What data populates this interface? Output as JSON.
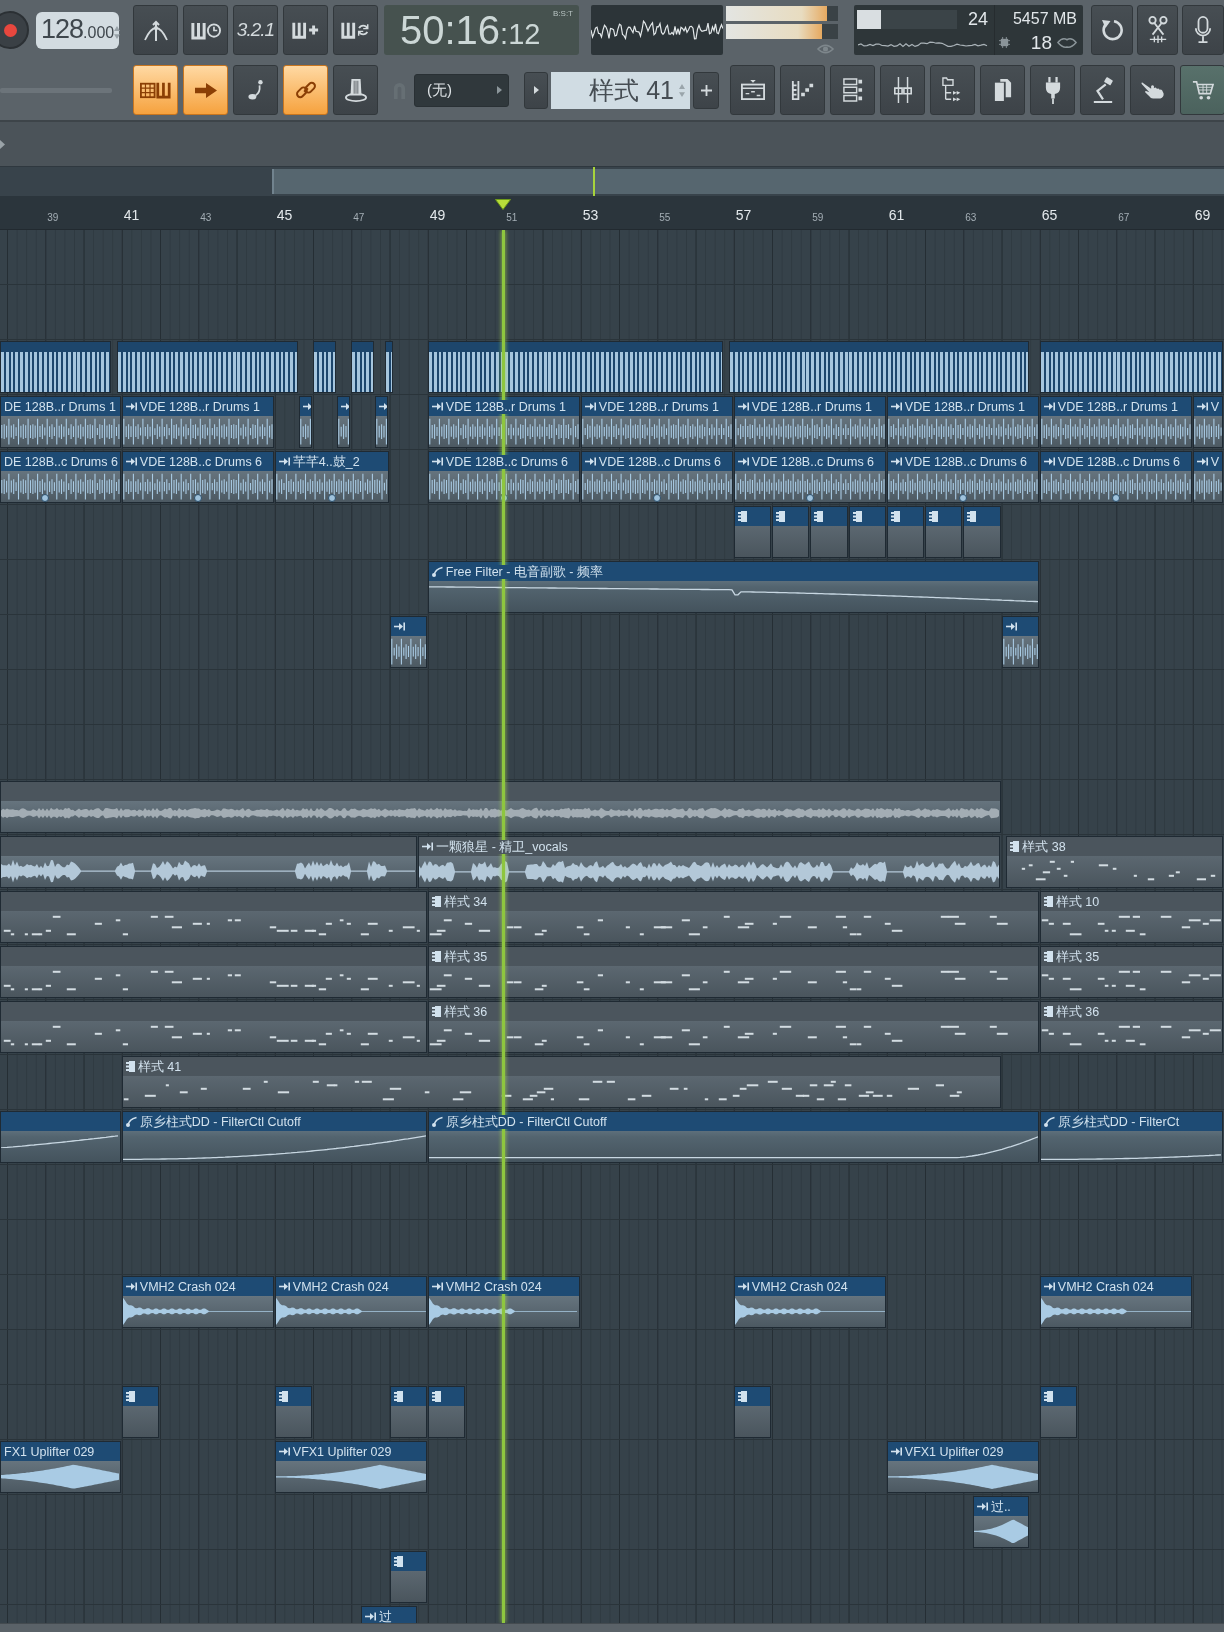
{
  "toolbar": {
    "tempo": {
      "value": "128",
      "decimals": ".000"
    },
    "record_buttons": [
      {
        "kind": "metronome",
        "on": false
      },
      {
        "kind": "keys-clock",
        "on": false
      },
      {
        "kind": "countdown",
        "label": "3.2.1",
        "on": false
      },
      {
        "kind": "keys-plus",
        "on": false
      },
      {
        "kind": "keys-loop",
        "on": false
      }
    ],
    "time": {
      "value": "50:16",
      "ticks": ":12",
      "format": "B:S:T"
    },
    "peak_meters": [
      {
        "level": 0.9
      },
      {
        "level": 0.86
      }
    ],
    "cpu": {
      "reading": "24",
      "level": 0.24
    },
    "memory": "5457 MB",
    "polyphony": "18",
    "tool_buttons": [
      {
        "kind": "undo"
      },
      {
        "kind": "scissors"
      },
      {
        "kind": "microphone"
      }
    ],
    "mode_toggles": [
      {
        "kind": "keys-grid",
        "on": true
      },
      {
        "kind": "arrow",
        "on": true
      },
      {
        "kind": "step",
        "on": false
      },
      {
        "kind": "link",
        "on": true
      },
      {
        "kind": "knob",
        "on": false
      }
    ],
    "snap": {
      "value": "(无)"
    },
    "pattern_selector": {
      "value": "样式 41"
    },
    "window_buttons": [
      {
        "kind": "playlist"
      },
      {
        "kind": "piano-roll"
      },
      {
        "kind": "channel-rack"
      },
      {
        "kind": "mixer"
      },
      {
        "kind": "browser"
      },
      {
        "kind": "files"
      },
      {
        "kind": "plugin"
      },
      {
        "kind": "lamp"
      },
      {
        "kind": "hand"
      },
      {
        "kind": "cart"
      }
    ]
  },
  "playlist": {
    "ruler": [
      "39",
      "41",
      "43",
      "45",
      "47",
      "49",
      "51",
      "53",
      "55",
      "57",
      "59",
      "61",
      "63",
      "65",
      "67",
      "69"
    ],
    "tracks": [
      {
        "clips": [
          {
            "kind": "slices",
            "color": "#1d466c"
          },
          {
            "kind": "slices",
            "color": "#1d466c"
          },
          {
            "kind": "slices",
            "color": "#1d466c"
          },
          {
            "kind": "slices",
            "color": "#1d466c"
          },
          {
            "kind": "slices",
            "color": "#1d466c"
          },
          {
            "kind": "slices",
            "color": "#1d466c"
          },
          {
            "kind": "slices",
            "color": "#1d466c"
          },
          {
            "kind": "slices",
            "color": "#1d466c"
          }
        ]
      },
      {
        "clips": [
          {
            "kind": "audio",
            "color": "#1e4b74",
            "label": "DE 128B..r Drums 1"
          },
          {
            "kind": "audio",
            "color": "#1e4b74",
            "label": "VDE 128B..r Drums 1"
          },
          {
            "kind": "audio",
            "color": "#1e4b74"
          },
          {
            "kind": "audio",
            "color": "#1e4b74"
          },
          {
            "kind": "audio",
            "color": "#1e4b74"
          },
          {
            "kind": "audio",
            "color": "#1e4b74",
            "label": "VDE 128B..r Drums 1"
          },
          {
            "kind": "audio",
            "color": "#1e4b74",
            "label": "VDE 128B..r Drums 1"
          },
          {
            "kind": "audio",
            "color": "#1e4b74",
            "label": "VDE 128B..r Drums 1"
          },
          {
            "kind": "audio",
            "color": "#1e4b74",
            "label": "VDE 128B..r Drums 1"
          },
          {
            "kind": "audio",
            "color": "#1e4b74",
            "label": "VDE 128B..r Drums 1"
          },
          {
            "kind": "audio",
            "color": "#1e4b74",
            "label": "V"
          }
        ]
      },
      {
        "clips": [
          {
            "kind": "audio",
            "color": "#1e4b74",
            "label": "DE 128B..c Drums 6",
            "marker": true
          },
          {
            "kind": "audio",
            "color": "#1e4b74",
            "label": "VDE 128B..c Drums 6",
            "marker": true
          },
          {
            "kind": "audio",
            "color": "#1e4b74",
            "label": "芊芊4..鼓_2",
            "marker": true
          },
          {
            "kind": "audio",
            "color": "#1e4b74",
            "label": "VDE 128B..c Drums 6",
            "marker": true
          },
          {
            "kind": "audio",
            "color": "#1e4b74",
            "label": "VDE 128B..c Drums 6",
            "marker": true
          },
          {
            "kind": "audio",
            "color": "#1e4b74",
            "label": "VDE 128B..c Drums 6",
            "marker": true
          },
          {
            "kind": "audio",
            "color": "#1e4b74",
            "label": "VDE 128B..c Drums 6",
            "marker": true
          },
          {
            "kind": "audio",
            "color": "#1e4b74",
            "label": "VDE 128B..c Drums 6",
            "marker": true
          },
          {
            "kind": "audio",
            "color": "#1e4b74",
            "label": "V"
          }
        ]
      },
      {
        "clips": [
          {
            "kind": "pattern",
            "color": "#1e4b74"
          },
          {
            "kind": "pattern",
            "color": "#1e4b74"
          },
          {
            "kind": "pattern",
            "color": "#1e4b74"
          },
          {
            "kind": "pattern",
            "color": "#1e4b74"
          },
          {
            "kind": "pattern",
            "color": "#1e4b74"
          },
          {
            "kind": "pattern",
            "color": "#1e4b74"
          },
          {
            "kind": "pattern",
            "color": "#1e4b74"
          }
        ]
      },
      {
        "clips": [
          {
            "kind": "automation",
            "color": "#1e4b74",
            "label": "Free Filter - 电音副歌 - 频率"
          }
        ]
      },
      {
        "clips": [
          {
            "kind": "audio",
            "color": "#1e4b74"
          },
          {
            "kind": "audio",
            "color": "#1e4b74"
          }
        ]
      },
      {
        "clips": [
          {
            "kind": "audio",
            "color": "#4b555d"
          }
        ]
      },
      {
        "clips": [
          {
            "kind": "audio",
            "color": "#4b555d"
          },
          {
            "kind": "audio",
            "color": "#4b555d",
            "label": "一颗狼星 - 精卫_vocals"
          },
          {
            "kind": "pattern",
            "color": "#4b555d",
            "label": "样式 38"
          }
        ]
      },
      {
        "clips": [
          {
            "kind": "pattern",
            "color": "#4b555d"
          },
          {
            "kind": "pattern",
            "color": "#4b555d",
            "label": "样式 34"
          },
          {
            "kind": "pattern",
            "color": "#4b555d",
            "label": "样式 10"
          }
        ]
      },
      {
        "clips": [
          {
            "kind": "pattern",
            "color": "#4b555d"
          },
          {
            "kind": "pattern",
            "color": "#4b555d",
            "label": "样式 35"
          },
          {
            "kind": "pattern",
            "color": "#4b555d",
            "label": "样式 35"
          }
        ]
      },
      {
        "clips": [
          {
            "kind": "pattern",
            "color": "#4b555d"
          },
          {
            "kind": "pattern",
            "color": "#4b555d",
            "label": "样式 36"
          },
          {
            "kind": "pattern",
            "color": "#4b555d",
            "label": "样式 36"
          }
        ]
      },
      {
        "clips": [
          {
            "kind": "pattern",
            "color": "#4b555d",
            "label": "样式 41"
          }
        ]
      },
      {
        "clips": [
          {
            "kind": "automation",
            "color": "#1e4b74"
          },
          {
            "kind": "automation",
            "color": "#1e4b74",
            "label": "原乡柱式DD - FilterCtl Cutoff"
          },
          {
            "kind": "automation",
            "color": "#1e4b74",
            "label": "原乡柱式DD - FilterCtl Cutoff"
          },
          {
            "kind": "automation",
            "color": "#1e4b74",
            "label": "原乡柱式DD - FilterCt"
          }
        ]
      },
      {
        "clips": [
          {
            "kind": "audio",
            "color": "#1e4b74",
            "label": "VMH2 Crash 024"
          },
          {
            "kind": "audio",
            "color": "#1e4b74",
            "label": "VMH2 Crash 024"
          },
          {
            "kind": "audio",
            "color": "#1e4b74",
            "label": "VMH2 Crash 024"
          },
          {
            "kind": "audio",
            "color": "#1e4b74",
            "label": "VMH2 Crash 024"
          },
          {
            "kind": "audio",
            "color": "#1e4b74",
            "label": "VMH2 Crash 024"
          }
        ]
      },
      {
        "clips": [
          {
            "kind": "pattern",
            "color": "#1e4b74"
          },
          {
            "kind": "pattern",
            "color": "#1e4b74"
          },
          {
            "kind": "pattern",
            "color": "#1e4b74"
          },
          {
            "kind": "pattern",
            "color": "#1e4b74"
          },
          {
            "kind": "pattern",
            "color": "#1e4b74"
          },
          {
            "kind": "pattern",
            "color": "#1e4b74"
          }
        ]
      },
      {
        "clips": [
          {
            "kind": "audio",
            "color": "#1e4b74",
            "label": "FX1 Uplifter 029"
          },
          {
            "kind": "audio",
            "color": "#1e4b74",
            "label": "VFX1 Uplifter 029"
          },
          {
            "kind": "audio",
            "color": "#1e4b74",
            "label": "VFX1 Uplifter 029"
          }
        ]
      },
      {
        "clips": [
          {
            "kind": "audio",
            "color": "#1e4b74",
            "label": "过.."
          }
        ]
      },
      {
        "clips": [
          {
            "kind": "pattern",
            "color": "#1e4b74"
          }
        ]
      },
      {
        "clips": [
          {
            "kind": "audio",
            "color": "#1e4b74",
            "label": "过"
          }
        ]
      }
    ]
  }
}
